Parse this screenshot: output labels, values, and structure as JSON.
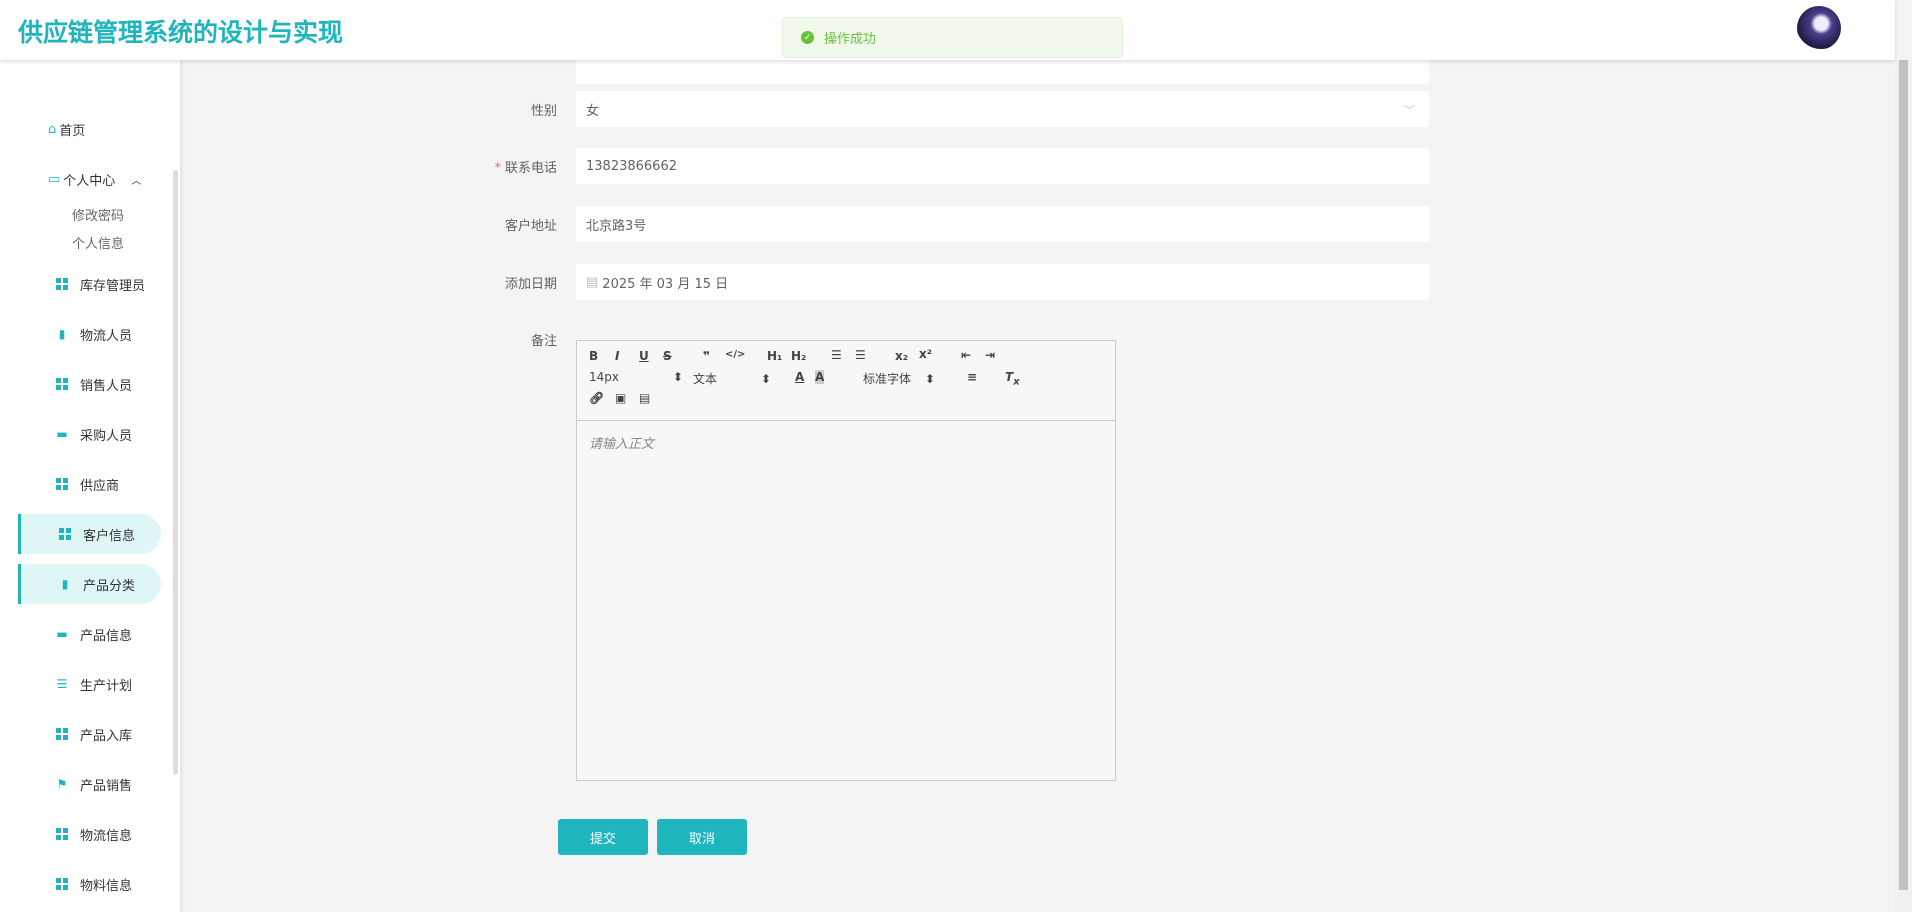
{
  "header": {
    "title": "供应链管理系统的设计与实现"
  },
  "toast": {
    "message": "操作成功",
    "color": "#67c23a"
  },
  "sidebar": {
    "home": "首页",
    "personal": "个人中心",
    "personal_sub": [
      "修改密码",
      "个人信息"
    ],
    "items": [
      {
        "label": "库存管理员",
        "icon": "grid-icon"
      },
      {
        "label": "物流人员",
        "icon": "clipboard-icon"
      },
      {
        "label": "销售人员",
        "icon": "grid-icon"
      },
      {
        "label": "采购人员",
        "icon": "briefcase-icon"
      },
      {
        "label": "供应商",
        "icon": "grid-icon"
      },
      {
        "label": "客户信息",
        "icon": "grid-icon",
        "active": true
      },
      {
        "label": "产品分类",
        "icon": "clipboard-icon",
        "active": true
      },
      {
        "label": "产品信息",
        "icon": "monitor-icon"
      },
      {
        "label": "生产计划",
        "icon": "list-icon"
      },
      {
        "label": "产品入库",
        "icon": "grid-icon"
      },
      {
        "label": "产品销售",
        "icon": "flag-icon"
      },
      {
        "label": "物流信息",
        "icon": "grid-icon"
      },
      {
        "label": "物料信息",
        "icon": "grid-icon"
      }
    ]
  },
  "form": {
    "gender": {
      "label": "性别",
      "value": "女"
    },
    "phone": {
      "label": "联系电话",
      "value": "13823866662",
      "required": "*"
    },
    "address": {
      "label": "客户地址",
      "value": "北京路3号"
    },
    "date": {
      "label": "添加日期",
      "value": "2025 年 03 月 15 日"
    },
    "remark": {
      "label": "备注",
      "placeholder": "请输入正文"
    },
    "toolbar": {
      "font_size": "14px",
      "format": "文本",
      "font": "标准字体"
    },
    "submit": "提交",
    "cancel": "取消"
  },
  "accent": "#1fb5bd"
}
